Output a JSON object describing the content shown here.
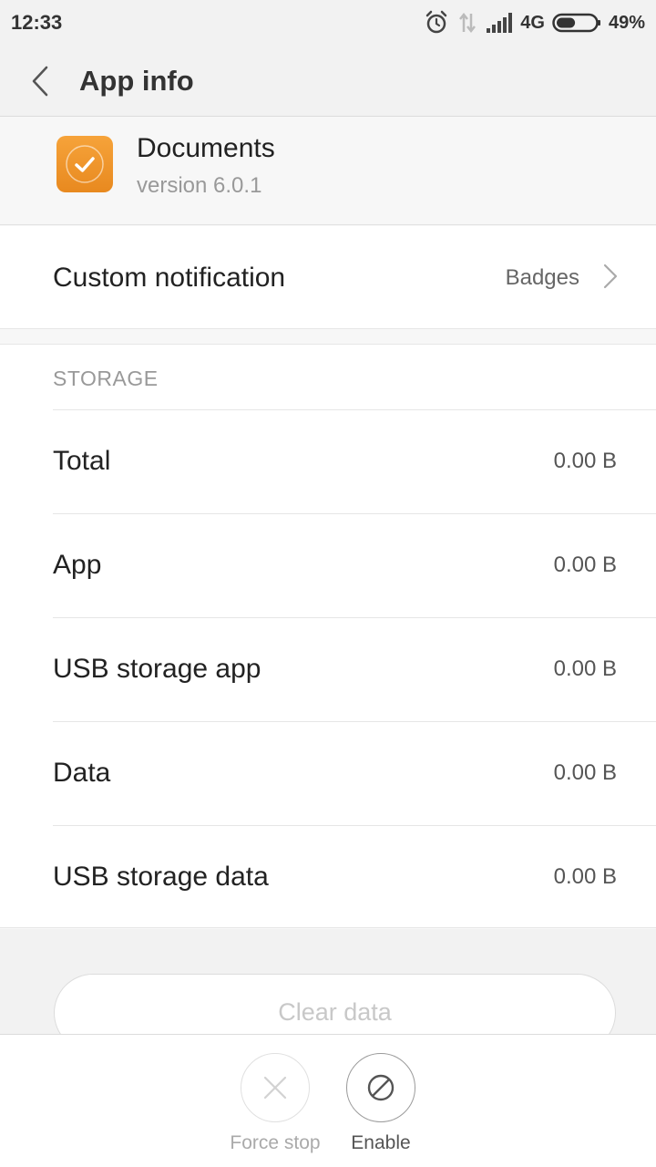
{
  "status_bar": {
    "time": "12:33",
    "network": "4G",
    "battery": "49%",
    "battery_level": 0.49,
    "icons": [
      "alarm-icon",
      "data-arrows-icon",
      "signal-icon",
      "battery-icon"
    ]
  },
  "header": {
    "title": "App info"
  },
  "app": {
    "name": "Documents",
    "version": "version 6.0.1",
    "icon_color": "#f19a2c"
  },
  "notification": {
    "label": "Custom notification",
    "value": "Badges"
  },
  "storage": {
    "section_title": "STORAGE",
    "rows": [
      {
        "label": "Total",
        "value": "0.00 B"
      },
      {
        "label": "App",
        "value": "0.00 B"
      },
      {
        "label": "USB storage app",
        "value": "0.00 B"
      },
      {
        "label": "Data",
        "value": "0.00 B"
      },
      {
        "label": "USB storage data",
        "value": "0.00 B"
      }
    ]
  },
  "actions": {
    "clear_data": "Clear data",
    "force_stop": "Force stop",
    "enable": "Enable"
  }
}
